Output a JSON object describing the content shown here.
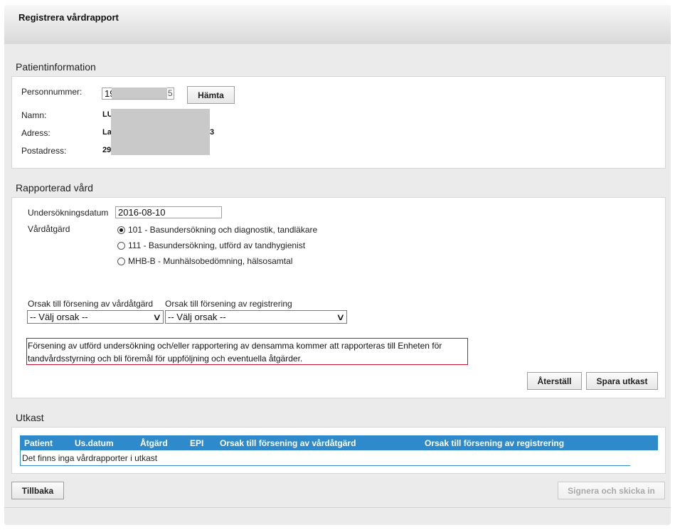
{
  "header": {
    "title": "Registrera vårdrapport"
  },
  "patient": {
    "section_title": "Patientinformation",
    "personnummer_label": "Personnummer:",
    "personnummer_value": "19",
    "personnummer_tail": "5",
    "hamta_label": "Hämta",
    "namn_label": "Namn:",
    "namn_value": "LU",
    "adress_label": "Adress:",
    "adress_value": "La",
    "adress_tail": "3",
    "postadress_label": "Postadress:",
    "postadress_value": "29"
  },
  "care": {
    "section_title": "Rapporterad vård",
    "date_label": "Undersökningsdatum",
    "date_value": "2016-08-10",
    "measure_label": "Vårdåtgärd",
    "options": [
      {
        "label": "101 - Basundersökning och diagnostik, tandläkare",
        "selected": true
      },
      {
        "label": "111 - Basundersökning, utförd av tandhygienist",
        "selected": false
      },
      {
        "label": "MHB-B - Munhälsobedömning, hälsosamtal",
        "selected": false
      }
    ],
    "delay_measure_label": "Orsak till försening av vårdåtgärd",
    "delay_measure_value": "-- Välj orsak --",
    "delay_registration_label": "Orsak till försening av registrering",
    "delay_registration_value": "-- Välj orsak --",
    "warning_text": "Försening av utförd undersökning och/eller rapportering av densamma kommer att rapporteras till Enheten för tandvårdsstyrning och bli föremål för uppföljning och eventuella åtgärder.",
    "reset_label": "Återställ",
    "save_draft_label": "Spara utkast"
  },
  "drafts": {
    "section_title": "Utkast",
    "columns": [
      "Patient",
      "Us.datum",
      "Åtgärd",
      "EPI",
      "Orsak till försening av vårdåtgärd",
      "Orsak till försening av registrering"
    ],
    "empty_text": "Det finns inga vårdrapporter i utkast"
  },
  "footer": {
    "back_label": "Tillbaka",
    "sign_label": "Signera och skicka in"
  }
}
